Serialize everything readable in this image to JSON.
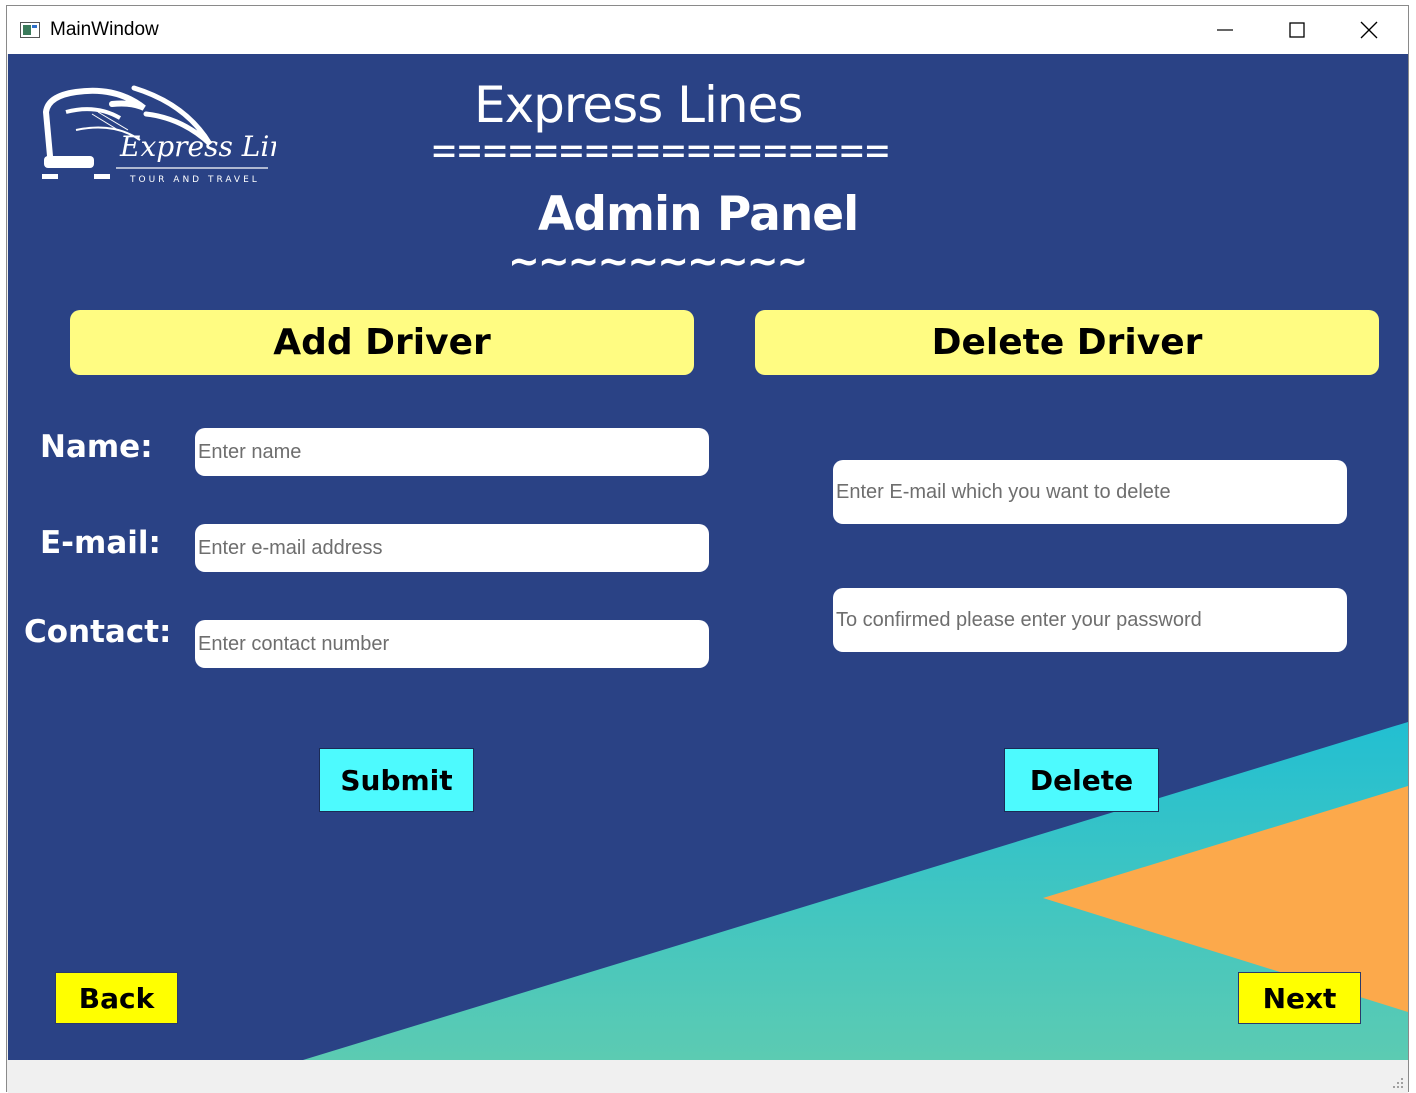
{
  "window": {
    "title": "MainWindow",
    "minimize_icon": "minimize-icon",
    "maximize_icon": "maximize-icon",
    "close_icon": "close-icon"
  },
  "colors": {
    "background": "#2a4285",
    "header_fill": "#fffc82",
    "action_button": "#4dfafe",
    "nav_button": "#ffff00",
    "teal": "#2fc3cd",
    "orange": "#fca94b"
  },
  "logo": {
    "brand": "Express Lines",
    "tagline": "TOUR AND TRAVEL"
  },
  "header": {
    "title": "Express Lines",
    "title_rule": "==================",
    "subtitle": "Admin Panel",
    "subtitle_rule": "~~~~~~~~~~"
  },
  "add_driver": {
    "heading": "Add Driver",
    "name_label": "Name:",
    "name_placeholder": "Enter name",
    "email_label": "E-mail:",
    "email_placeholder": "Enter e-mail address",
    "contact_label": "Contact:",
    "contact_placeholder": "Enter contact number",
    "submit_label": "Submit"
  },
  "delete_driver": {
    "heading": "Delete Driver",
    "email_placeholder": "Enter E-mail which you want to delete",
    "password_placeholder": "To confirmed please enter your password",
    "delete_label": "Delete"
  },
  "nav": {
    "back_label": "Back",
    "next_label": "Next"
  }
}
